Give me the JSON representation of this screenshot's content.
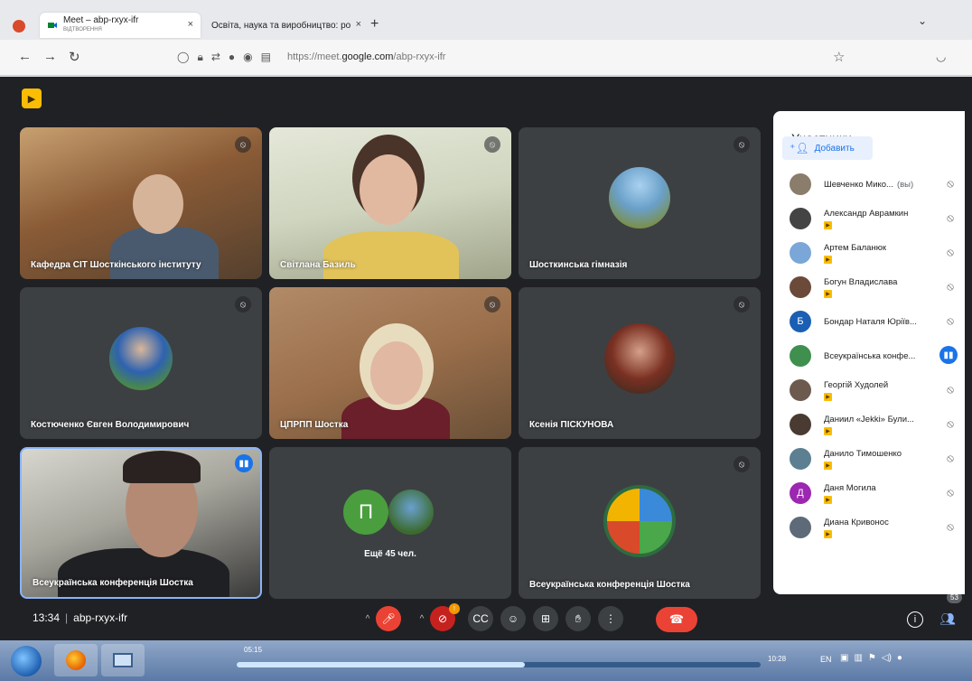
{
  "browser": {
    "tabs": [
      {
        "title": "Meet – abp-rxyx-ifr",
        "subtitle": "ВІДТВОРЕННЯ",
        "close": "×",
        "active": true
      },
      {
        "title": "Освіта, наука та виробництво: ро",
        "close": "×",
        "active": false
      }
    ],
    "new_tab": "+",
    "url_prefix": "https://meet.",
    "url_domain": "google.com",
    "url_path": "/abp-rxyx-ifr"
  },
  "tiles": [
    {
      "name": "Кафедра СІТ Шосткінського інституту"
    },
    {
      "name": "Світлана Базиль"
    },
    {
      "name": "Шосткинська гімназія"
    },
    {
      "name": "Костюченко Євген Володимирович"
    },
    {
      "name": "ЦПРПП Шостка"
    },
    {
      "name": "Ксенія ПІСКУНОВА"
    },
    {
      "name": "Всеукраїнська конференція Шостка"
    },
    {
      "name": "Ещё 45 чел.",
      "initial": "П"
    },
    {
      "name": "Всеукраїнська конференція Шостка"
    }
  ],
  "panel": {
    "title": "Участники",
    "add_label": "Добавить",
    "participants": [
      {
        "name": "Шевченко Мико...",
        "you": "(вы)",
        "avatar": "",
        "color": "#8b7d6b"
      },
      {
        "name": "Александр Аврамкин",
        "avatar": "",
        "color": "#444444"
      },
      {
        "name": "Артем Баланюк",
        "avatar": "",
        "color": "#7aa7d8"
      },
      {
        "name": "Богун Владислава",
        "avatar": "",
        "color": "#6b4a3a"
      },
      {
        "name": "Бондар Наталя Юріїв...",
        "avatar": "Б",
        "color": "#1a5fb4"
      },
      {
        "name": "Всеукраїнська конфе...",
        "avatar": "",
        "color": "#3f8f4f"
      },
      {
        "name": "Георгій Худолей",
        "avatar": "",
        "color": "#6d5a4f"
      },
      {
        "name": "Даниил «Jekki» Були...",
        "avatar": "",
        "color": "#4a3b32"
      },
      {
        "name": "Данило Тимошенко",
        "avatar": "",
        "color": "#5c7f92"
      },
      {
        "name": "Даня Могила",
        "avatar": "Д",
        "color": "#9c27b0"
      },
      {
        "name": "Диана Кривонос",
        "avatar": "",
        "color": "#5e6a78"
      }
    ]
  },
  "bottom": {
    "time": "13:34",
    "separator": "|",
    "meeting_code": "abp-rxyx-ifr",
    "people_count": "53",
    "activity_badge": "!"
  },
  "taskbar": {
    "media_time": "05:15",
    "media_end": "10:28",
    "media_progress": 0.55,
    "language": "EN"
  }
}
